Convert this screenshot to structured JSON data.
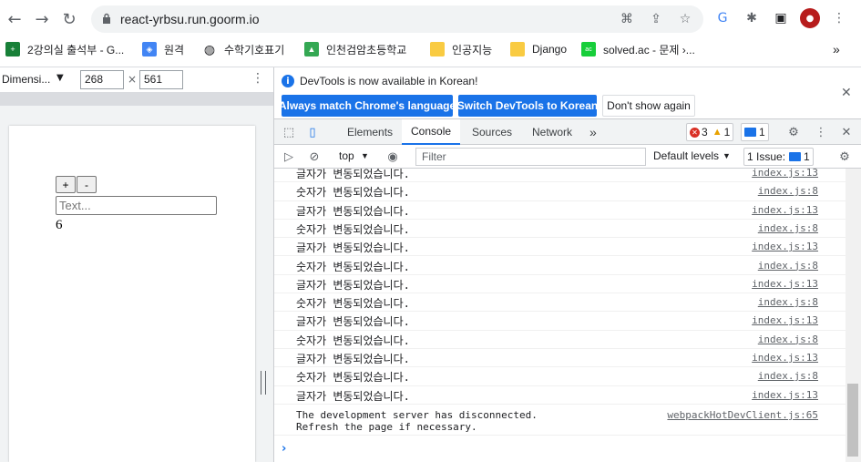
{
  "browser": {
    "url": "react-yrbsu.run.goorm.io",
    "bookmarks": [
      {
        "label": "2강의실 출석부 - G...",
        "icon": "sheets-icon",
        "color": "#188038"
      },
      {
        "label": "원격",
        "icon": "chrome-remote-icon",
        "color": "#4285f4"
      },
      {
        "label": "수학기호표기",
        "icon": "globe-icon",
        "color": "#202124"
      },
      {
        "label": "인천검암초등학교",
        "icon": "school-icon",
        "color": "#34a853"
      },
      {
        "label": "인공지능",
        "icon": "folder-icon",
        "color": "#f9cb42"
      },
      {
        "label": "Django",
        "icon": "folder-icon",
        "color": "#f9cb42"
      },
      {
        "label": "solved.ac - 문제 ›...",
        "icon": "solvedac-icon",
        "color": "#17ce3a"
      }
    ],
    "bookmarks_more": "»"
  },
  "device_toolbar": {
    "dimension_label": "Dimensi...",
    "width": "268",
    "height": "561",
    "times": "×"
  },
  "app": {
    "plus_label": "+",
    "minus_label": "-",
    "text_placeholder": "Text...",
    "count": "6"
  },
  "devtools": {
    "info_text": "DevTools is now available in Korean!",
    "btn_match": "Always match Chrome's language",
    "btn_switch": "Switch DevTools to Korean",
    "btn_dont_show": "Don't show again",
    "tabs": [
      "Elements",
      "Console",
      "Sources",
      "Network"
    ],
    "tabs_more": "»",
    "error_count": "3",
    "warning_count": "1",
    "message_count": "1",
    "context": "top",
    "filter_placeholder": "Filter",
    "levels": "Default levels",
    "issues_label": "1 Issue:",
    "issues_count": "1"
  },
  "console": {
    "logs": [
      {
        "msg": "글자가 변동되었습니다.",
        "src": "index.js:13"
      },
      {
        "msg": "숫자가 변동되었습니다.",
        "src": "index.js:8"
      },
      {
        "msg": "글자가 변동되었습니다.",
        "src": "index.js:13"
      },
      {
        "msg": "숫자가 변동되었습니다.",
        "src": "index.js:8"
      },
      {
        "msg": "글자가 변동되었습니다.",
        "src": "index.js:13"
      },
      {
        "msg": "숫자가 변동되었습니다.",
        "src": "index.js:8"
      },
      {
        "msg": "글자가 변동되었습니다.",
        "src": "index.js:13"
      },
      {
        "msg": "숫자가 변동되었습니다.",
        "src": "index.js:8"
      },
      {
        "msg": "글자가 변동되었습니다.",
        "src": "index.js:13"
      },
      {
        "msg": "숫자가 변동되었습니다.",
        "src": "index.js:8"
      },
      {
        "msg": "글자가 변동되었습니다.",
        "src": "index.js:13"
      },
      {
        "msg": "숫자가 변동되었습니다.",
        "src": "index.js:8"
      },
      {
        "msg": "글자가 변동되었습니다.",
        "src": "index.js:13"
      }
    ],
    "server_msg": "The development server has disconnected.\nRefresh the page if necessary.",
    "server_src": "webpackHotDevClient.js:65",
    "prompt": "›"
  }
}
